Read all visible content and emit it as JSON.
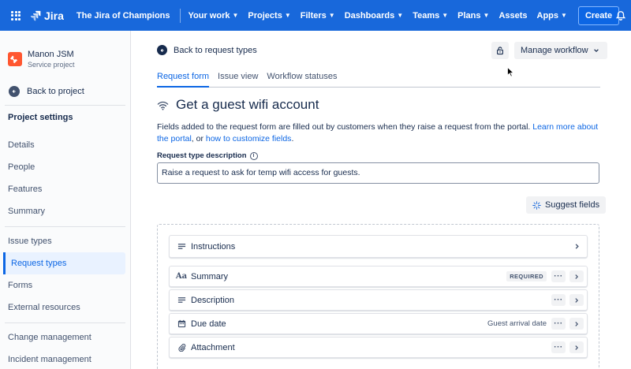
{
  "nav": {
    "logo": "Jira",
    "site": "The Jira of Champions",
    "items": [
      {
        "label": "Your work"
      },
      {
        "label": "Projects"
      },
      {
        "label": "Filters"
      },
      {
        "label": "Dashboards"
      },
      {
        "label": "Teams"
      },
      {
        "label": "Plans"
      },
      {
        "label": "Assets"
      },
      {
        "label": "Apps"
      }
    ],
    "create_label": "Create",
    "accent": "#1868db"
  },
  "sidebar": {
    "project_name": "Manon JSM",
    "project_type": "Service project",
    "back_label": "Back to project",
    "section_title": "Project settings",
    "group1": [
      "Details",
      "People",
      "Features",
      "Summary"
    ],
    "group2": [
      "Issue types",
      "Request types",
      "Forms",
      "External resources"
    ],
    "group3": [
      "Change management",
      "Incident management"
    ],
    "active_item": "Request types"
  },
  "main": {
    "back_label": "Back to request types",
    "manage_workflow_label": "Manage workflow",
    "tabs": [
      "Request form",
      "Issue view",
      "Workflow statuses"
    ],
    "title": "Get a guest wifi account",
    "intro_text": "Fields added to the request form are filled out by customers when they raise a request from the portal. ",
    "intro_link1": "Learn more about the portal",
    "intro_mid": ", or ",
    "intro_link2": "how to customize fields",
    "intro_end": ".",
    "desc_label": "Request type description",
    "desc_value": "Raise a request to ask for temp wifi access for guests.",
    "suggest_label": "Suggest fields",
    "fields": [
      {
        "label": "Instructions",
        "icon": "text-lines-icon",
        "badge": "",
        "meta": ""
      },
      {
        "label": "Summary",
        "icon": "text-style-icon",
        "badge": "REQUIRED",
        "meta": ""
      },
      {
        "label": "Description",
        "icon": "text-lines-icon",
        "badge": "",
        "meta": ""
      },
      {
        "label": "Due date",
        "icon": "calendar-icon",
        "badge": "",
        "meta": "Guest arrival date"
      },
      {
        "label": "Attachment",
        "icon": "paperclip-icon",
        "badge": "",
        "meta": ""
      }
    ]
  }
}
